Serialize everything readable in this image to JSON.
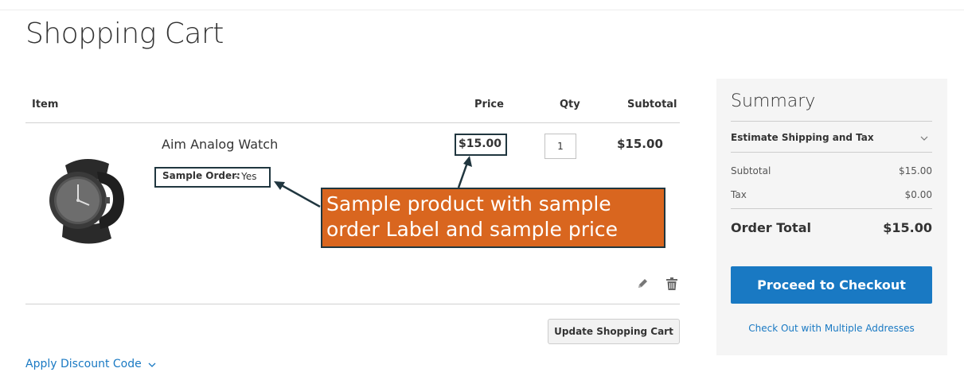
{
  "page": {
    "title": "Shopping Cart"
  },
  "cart": {
    "headers": {
      "item": "Item",
      "price": "Price",
      "qty": "Qty",
      "subtotal": "Subtotal"
    },
    "item": {
      "name": "Aim Analog Watch",
      "option_label": "Sample Order:",
      "option_value": "- Yes",
      "price": "$15.00",
      "qty": "1",
      "subtotal": "$15.00",
      "image_icon": "watch-image"
    },
    "annotation": "Sample product with sample order Label and sample price",
    "actions": {
      "edit_icon": "pencil-icon",
      "delete_icon": "trash-icon"
    },
    "update_button": "Update Shopping Cart",
    "discount_link": "Apply Discount Code"
  },
  "summary": {
    "title": "Summary",
    "estimate_label": "Estimate Shipping and Tax",
    "subtotal_label": "Subtotal",
    "subtotal_value": "$15.00",
    "tax_label": "Tax",
    "tax_value": "$0.00",
    "order_total_label": "Order Total",
    "order_total_value": "$15.00",
    "checkout_button": "Proceed to Checkout",
    "multi_address_link": "Check Out with Multiple Addresses"
  },
  "colors": {
    "accent": "#1979c3",
    "callout": "#d9661f",
    "callout_border": "#20363f",
    "summary_bg": "#f5f5f5"
  }
}
